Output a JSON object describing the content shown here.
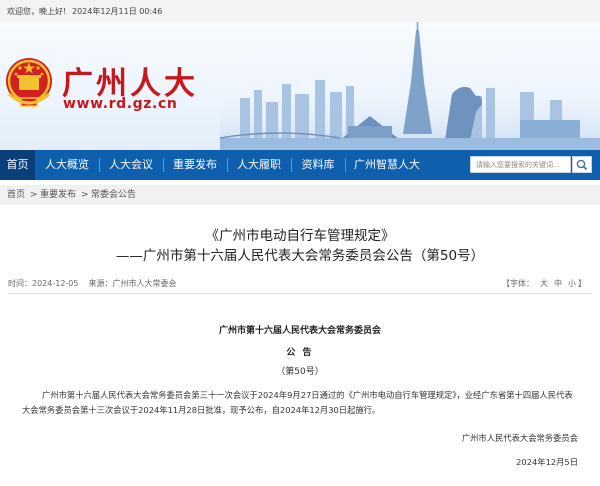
{
  "topbar": {
    "greeting": "欢迎您，晚上好!",
    "datetime": "2024年12月11日 00:46"
  },
  "header": {
    "site_name": "广州人大",
    "site_url": "www.rd.gz.cn"
  },
  "nav": {
    "items": [
      {
        "label": "首页"
      },
      {
        "label": "人大概览"
      },
      {
        "label": "人大会议"
      },
      {
        "label": "重要发布"
      },
      {
        "label": "人大履职"
      },
      {
        "label": "资料库"
      },
      {
        "label": "广州智慧人大"
      }
    ],
    "search_placeholder": "请输入您要搜索的关键词..."
  },
  "breadcrumb": {
    "home": "首页",
    "sep": ">",
    "level2": "重要发布",
    "level3": "常委会公告"
  },
  "article": {
    "title_line1": "《广州市电动自行车管理规定》",
    "title_line2": "——广州市第十六届人民代表大会常务委员会公告（第50号）",
    "date": "时间：2024-12-05",
    "source": "来源：广州市人大常委会",
    "font_size_label": "【字体：",
    "font_large": "大",
    "font_medium": "中",
    "font_small": "小",
    "font_close": "】",
    "issuer": "广州市第十六届人民代表大会常务委员会",
    "notice": "公 告",
    "number": "（第50号）",
    "paragraph": "广州市第十六届人民代表大会常务委员会第三十一次会议于2024年9月27日通过的《广州市电动自行车管理规定》，业经广东省第十四届人民代表大会常务委员会第十三次会议于2024年11月28日批准，现予公布，自2024年12月30日起施行。",
    "signature": "广州市人民代表大会常务委员会",
    "sign_date": "2024年12月5日"
  },
  "colors": {
    "brand_red": "#c8161d",
    "nav_blue": "#0f5faf",
    "nav_active": "#0a3f7c"
  }
}
